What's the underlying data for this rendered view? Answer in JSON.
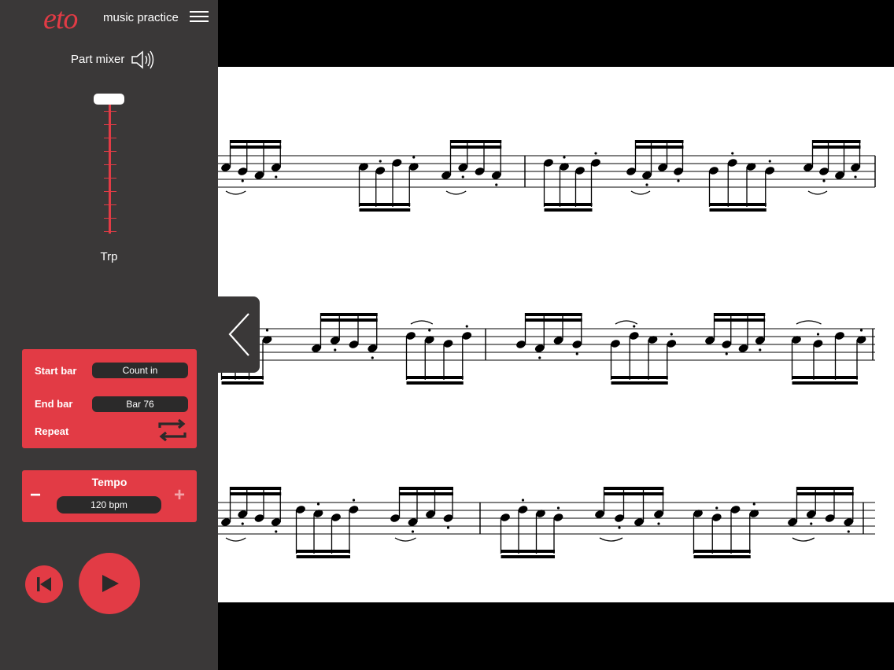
{
  "app": {
    "logo_text": "eto",
    "name": "music practice"
  },
  "mixer": {
    "label": "Part mixer",
    "part_name": "Trp",
    "volume_percent": 100
  },
  "loop": {
    "start_label": "Start bar",
    "start_value": "Count in",
    "end_label": "End bar",
    "end_value": "Bar 76",
    "repeat_label": "Repeat"
  },
  "tempo": {
    "title": "Tempo",
    "value": "120 bpm",
    "minus": "−",
    "plus": "+"
  },
  "colors": {
    "accent": "#e23b45",
    "sidebar": "#3a3838",
    "pill": "#2b2a2a"
  },
  "icons": [
    "menu-icon",
    "speaker-icon",
    "repeat-icon",
    "skip-back-icon",
    "play-icon",
    "chevron-left-icon"
  ]
}
